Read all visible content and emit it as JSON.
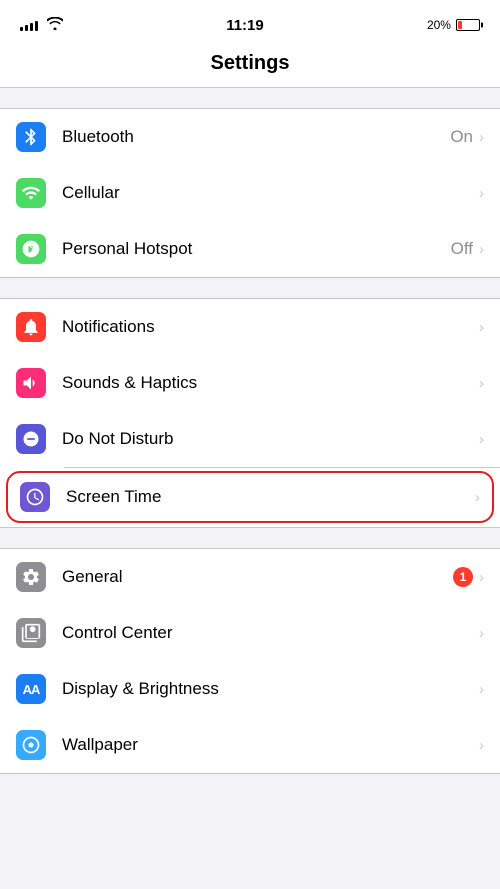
{
  "statusBar": {
    "time": "11:19",
    "batteryPercent": "20%",
    "batteryColor": "#ff3b30"
  },
  "header": {
    "title": "Settings"
  },
  "groups": [
    {
      "id": "connectivity",
      "items": [
        {
          "id": "bluetooth",
          "label": "Bluetooth",
          "value": "On",
          "hasValue": true,
          "iconClass": "icon-bluetooth",
          "iconSymbol": "bluetooth"
        },
        {
          "id": "cellular",
          "label": "Cellular",
          "value": "",
          "hasValue": false,
          "iconClass": "icon-cellular",
          "iconSymbol": "cellular"
        },
        {
          "id": "hotspot",
          "label": "Personal Hotspot",
          "value": "Off",
          "hasValue": true,
          "iconClass": "icon-hotspot",
          "iconSymbol": "hotspot"
        }
      ]
    },
    {
      "id": "notifications",
      "items": [
        {
          "id": "notifications",
          "label": "Notifications",
          "value": "",
          "hasValue": false,
          "iconClass": "icon-notifications",
          "iconSymbol": "notifications"
        },
        {
          "id": "sounds",
          "label": "Sounds & Haptics",
          "value": "",
          "hasValue": false,
          "iconClass": "icon-sounds",
          "iconSymbol": "sounds"
        },
        {
          "id": "donotdisturb",
          "label": "Do Not Disturb",
          "value": "",
          "hasValue": false,
          "iconClass": "icon-donotdisturb",
          "iconSymbol": "donotdisturb"
        },
        {
          "id": "screentime",
          "label": "Screen Time",
          "value": "",
          "hasValue": false,
          "iconClass": "icon-screentime",
          "iconSymbol": "screentime",
          "highlighted": true
        }
      ]
    },
    {
      "id": "system",
      "items": [
        {
          "id": "general",
          "label": "General",
          "value": "",
          "hasValue": false,
          "iconClass": "icon-general",
          "iconSymbol": "general",
          "badge": "1"
        },
        {
          "id": "controlcenter",
          "label": "Control Center",
          "value": "",
          "hasValue": false,
          "iconClass": "icon-controlcenter",
          "iconSymbol": "controlcenter"
        },
        {
          "id": "display",
          "label": "Display & Brightness",
          "value": "",
          "hasValue": false,
          "iconClass": "icon-display",
          "iconSymbol": "display"
        },
        {
          "id": "wallpaper",
          "label": "Wallpaper",
          "value": "",
          "hasValue": false,
          "iconClass": "icon-wallpaper",
          "iconSymbol": "wallpaper"
        }
      ]
    }
  ]
}
